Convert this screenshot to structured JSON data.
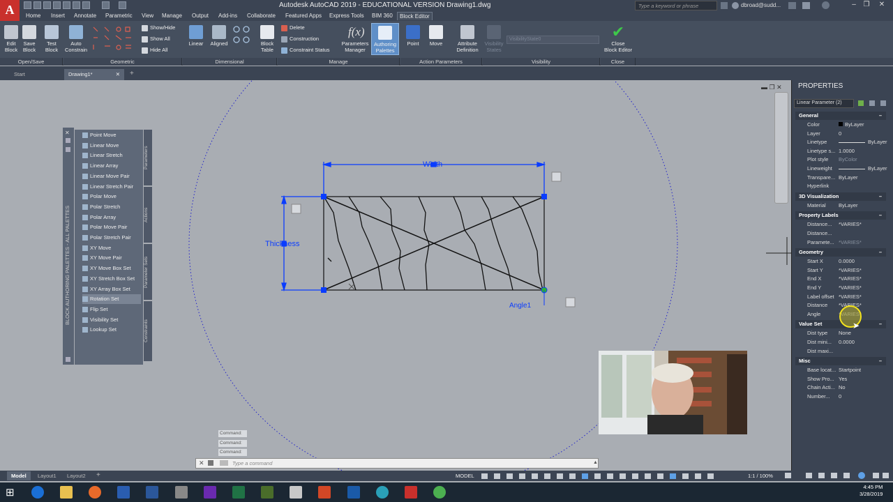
{
  "title_bar": {
    "app_logo": "A",
    "title": "Autodesk AutoCAD 2019 - EDUCATIONAL VERSION    Drawing1.dwg",
    "search_placeholder": "Type a keyword or phrase",
    "user": "dbroad@sudd..."
  },
  "menu_tabs": [
    "Home",
    "Insert",
    "Annotate",
    "Parametric",
    "View",
    "Manage",
    "Output",
    "Add-ins",
    "Collaborate",
    "Featured Apps",
    "Express Tools",
    "BIM 360",
    "Block Editor"
  ],
  "active_tab": "Block Editor",
  "ribbon": {
    "open_save": {
      "label": "Open/Save",
      "edit_block": "Edit\nBlock",
      "save_block": "Save\nBlock",
      "test_block": "Test\nBlock"
    },
    "geometric": {
      "label": "Geometric",
      "auto_constrain": "Auto\nConstrain"
    },
    "show_hide": "Show/Hide",
    "show_all": "Show All",
    "hide_all": "Hide All",
    "dimensional": {
      "label": "Dimensional",
      "linear": "Linear",
      "aligned": "Aligned",
      "block_table": "Block\nTable"
    },
    "manage": {
      "label": "Manage",
      "delete": "Delete",
      "construction": "Construction",
      "constraint_status": "Constraint Status"
    },
    "action_parameters": {
      "label": "Action Parameters",
      "parameters_manager": "Parameters\nManager",
      "authoring_palettes": "Authoring\nPalettes",
      "point": "Point",
      "move": "Move",
      "attribute_definition": "Attribute\nDefinition"
    },
    "visibility": {
      "label": "Visibility",
      "visibility_states": "Visibility\nStates",
      "visibility_dropdown": "VisibilityState0"
    },
    "close": {
      "label": "Close",
      "close_block_editor": "Close\nBlock Editor"
    }
  },
  "doc_tabs": [
    "Start",
    "Drawing1*"
  ],
  "palette": {
    "title": "BLOCK AUTHORING PALETTES - ALL PALETTES",
    "items": [
      "Point Move",
      "Linear Move",
      "Linear Stretch",
      "Linear Array",
      "Linear Move Pair",
      "Linear Stretch Pair",
      "Polar Move",
      "Polar Stretch",
      "Polar Array",
      "Polar Move Pair",
      "Polar Stretch Pair",
      "XY Move",
      "XY Move Pair",
      "XY Move Box Set",
      "XY Stretch Box Set",
      "XY Array Box Set",
      "Rotation Set",
      "Flip Set",
      "Visibility Set",
      "Lookup Set"
    ],
    "selected": "Rotation Set",
    "tabs": [
      "Parameters",
      "Actions",
      "Parameter Sets",
      "Constraints"
    ]
  },
  "drawing": {
    "width_label": "Width",
    "thickness_label": "Thickness",
    "angle_label": "Angle1"
  },
  "command": {
    "history": [
      "Command:",
      "Command:",
      "Command:"
    ],
    "placeholder": "Type a command"
  },
  "properties": {
    "title": "PROPERTIES",
    "selection": "Linear Parameter (2)",
    "sections": [
      {
        "name": "General",
        "rows": [
          {
            "k": "Color",
            "v": "ByLayer"
          },
          {
            "k": "Layer",
            "v": "0"
          },
          {
            "k": "Linetype",
            "v": "ByLayer"
          },
          {
            "k": "Linetype s...",
            "v": "1.0000"
          },
          {
            "k": "Plot style",
            "v": "ByColor"
          },
          {
            "k": "Lineweight",
            "v": "ByLayer"
          },
          {
            "k": "Transpare...",
            "v": "ByLayer"
          },
          {
            "k": "Hyperlink",
            "v": ""
          }
        ]
      },
      {
        "name": "3D Visualization",
        "rows": [
          {
            "k": "Material",
            "v": "ByLayer"
          }
        ]
      },
      {
        "name": "Property Labels",
        "rows": [
          {
            "k": "Distance...",
            "v": "*VARIES*"
          },
          {
            "k": "Distance...",
            "v": ""
          },
          {
            "k": "Paramete...",
            "v": "*VARIES*"
          }
        ]
      },
      {
        "name": "Geometry",
        "rows": [
          {
            "k": "Start X",
            "v": "0.0000"
          },
          {
            "k": "Start Y",
            "v": "*VARIES*"
          },
          {
            "k": "End X",
            "v": "*VARIES*"
          },
          {
            "k": "End Y",
            "v": "*VARIES*"
          },
          {
            "k": "Label offset",
            "v": "*VARIES*"
          },
          {
            "k": "Distance",
            "v": "*VARIES*"
          },
          {
            "k": "Angle",
            "v": "*VARIES*"
          }
        ]
      },
      {
        "name": "Value Set",
        "rows": [
          {
            "k": "Dist type",
            "v": "None"
          },
          {
            "k": "Dist mini...",
            "v": "0.0000"
          },
          {
            "k": "Dist maxi...",
            "v": ""
          }
        ]
      },
      {
        "name": "Misc",
        "rows": [
          {
            "k": "Base locat...",
            "v": "Startpoint"
          },
          {
            "k": "Show Pro...",
            "v": "Yes"
          },
          {
            "k": "Chain Acti...",
            "v": "No"
          },
          {
            "k": "Number...",
            "v": "0"
          }
        ]
      }
    ]
  },
  "status": {
    "layout_tabs": [
      "Model",
      "Layout1",
      "Layout2"
    ],
    "model": "MODEL",
    "scale": "1:1 / 100%"
  },
  "taskbar": {
    "time": "4:45 PM",
    "date": "3/28/2019"
  },
  "colors": {
    "accent": "#0a3cff",
    "titlebar": "#3b4453",
    "ribbon": "#454f5e",
    "canvas": "#a9adb3"
  }
}
